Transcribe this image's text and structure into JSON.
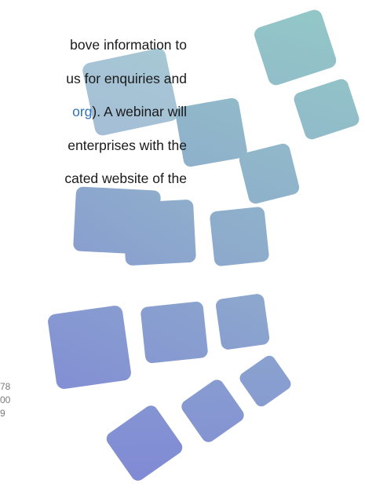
{
  "document": {
    "body_lines": [
      {
        "before": "bove information to",
        "link": "",
        "after": ""
      },
      {
        "before": "us for enquiries and",
        "link": "",
        "after": ""
      },
      {
        "before": "",
        "link": "org",
        "after": "). A webinar will"
      },
      {
        "before": "enterprises with the",
        "link": "",
        "after": ""
      },
      {
        "before": "cated website of the",
        "link": "",
        "after": ""
      }
    ],
    "footer_lines": [
      "78",
      "00",
      "9"
    ]
  },
  "colors": {
    "link": "#2e73b8",
    "tile_gradient_start": "#7f86d6",
    "tile_gradient_end": "#93c7c7"
  }
}
